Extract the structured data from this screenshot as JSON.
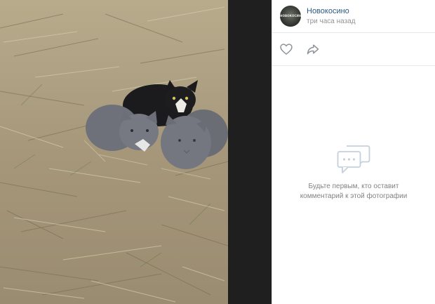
{
  "post": {
    "author_name": "Новокосино",
    "time": "три часа назад",
    "avatar_text": "НОВОКОСИНО"
  },
  "actions": {
    "like_icon": "heart-icon",
    "share_icon": "share-arrow-icon"
  },
  "comments": {
    "empty_icon": "comments-bubble-icon",
    "empty_text": "Будьте первым, кто оставит комментарий к этой фотографии"
  },
  "colors": {
    "author_link": "#2a5885",
    "muted_text": "#939393",
    "empty_text": "#828282",
    "icon_gray": "#909499",
    "backdrop": "#1f1f1f"
  }
}
